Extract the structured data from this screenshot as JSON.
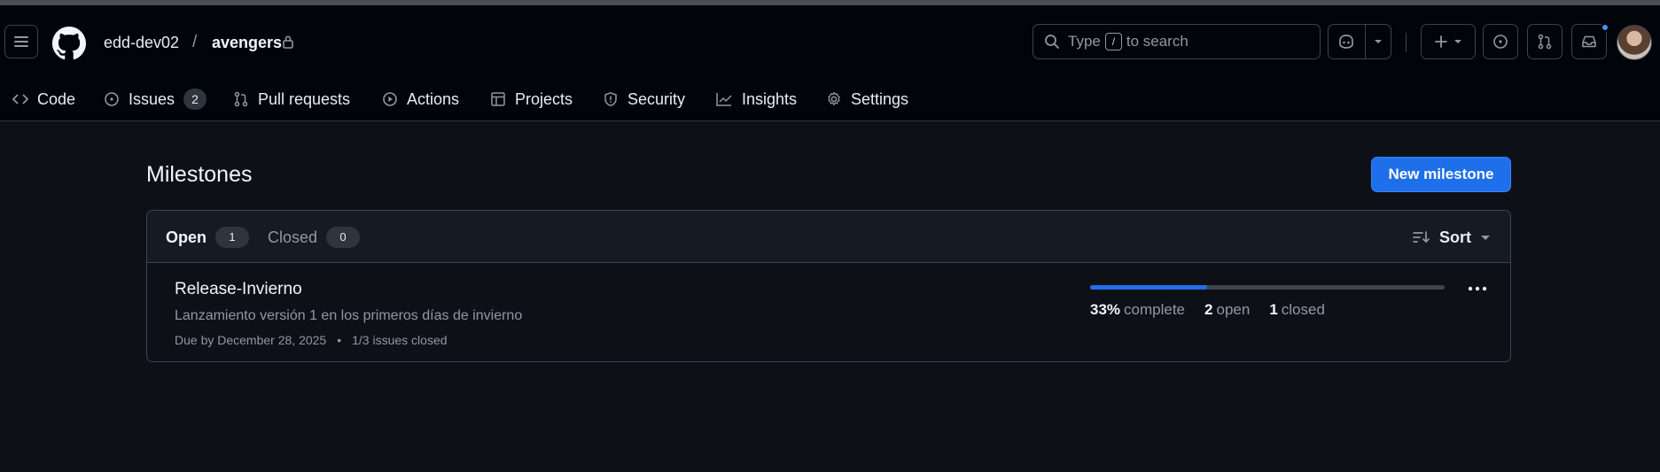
{
  "header": {
    "owner": "edd-dev02",
    "separator": "/",
    "repo": "avengers",
    "search_prefix": "Type",
    "search_key": "/",
    "search_suffix": "to search"
  },
  "tabs": [
    {
      "label": "Code"
    },
    {
      "label": "Issues",
      "count": "2"
    },
    {
      "label": "Pull requests"
    },
    {
      "label": "Actions"
    },
    {
      "label": "Projects"
    },
    {
      "label": "Security"
    },
    {
      "label": "Insights"
    },
    {
      "label": "Settings"
    }
  ],
  "page": {
    "title": "Milestones",
    "new_button": "New milestone"
  },
  "filters": {
    "open_label": "Open",
    "open_count": "1",
    "closed_label": "Closed",
    "closed_count": "0",
    "sort_label": "Sort"
  },
  "milestone": {
    "title": "Release-Invierno",
    "description": "Lanzamiento versión 1 en los primeros días de invierno",
    "due": "Due by December 28, 2025",
    "bullet": "•",
    "issues_closed": "1/3 issues closed",
    "progress_fraction": 0.33,
    "percent": "33%",
    "percent_label": "complete",
    "open_count": "2",
    "open_label": "open",
    "closed_count": "1",
    "closed_label": "closed"
  },
  "colors": {
    "accent": "#1f6feb",
    "notification": "#4493f8"
  }
}
